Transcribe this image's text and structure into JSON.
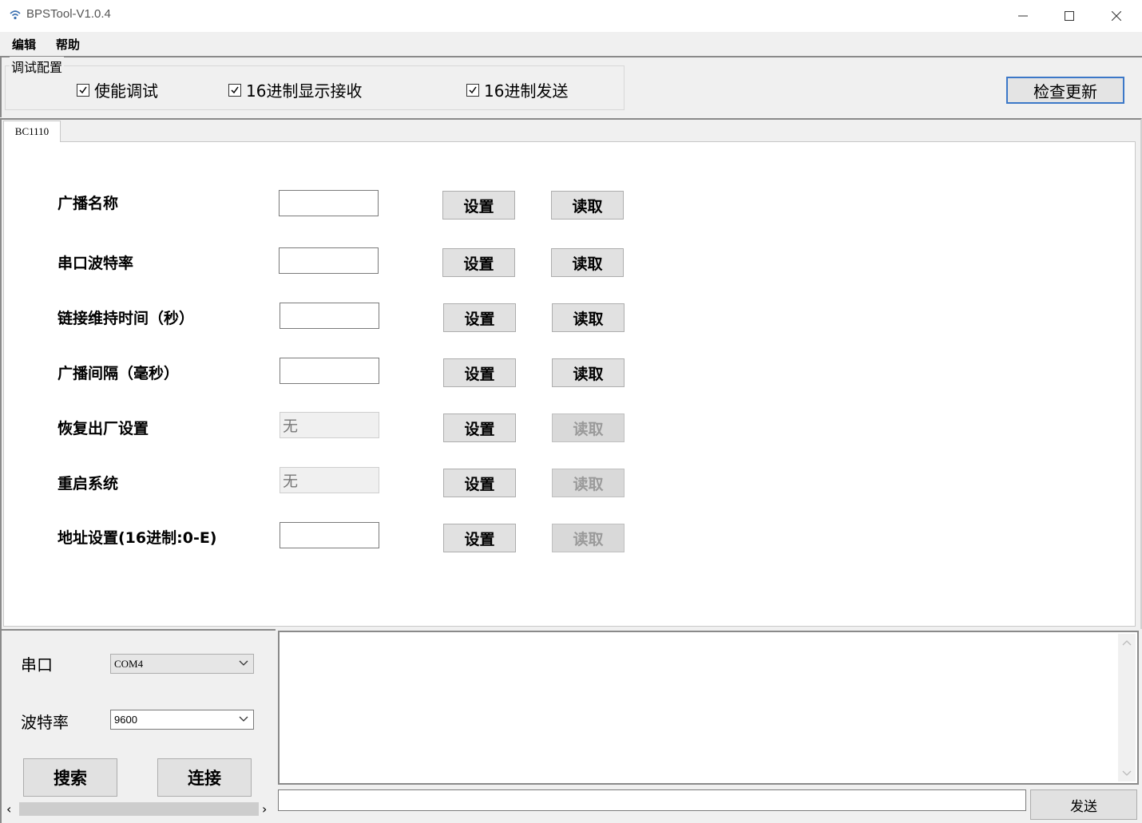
{
  "window": {
    "title": "BPSTool-V1.0.4",
    "minimize": "–",
    "maximize": "□",
    "close": "✕"
  },
  "menu": {
    "edit": "编辑",
    "help": "帮助"
  },
  "config": {
    "legend": "调试配置",
    "enable_debug": "使能调试",
    "hex_display": "16进制显示接收",
    "hex_send": "16进制发送",
    "check_update": "检查更新"
  },
  "tabs": [
    {
      "label": "BC1110"
    }
  ],
  "rows": [
    {
      "label": "广播名称",
      "value": "",
      "set": "设置",
      "read": "读取"
    },
    {
      "label": "串口波特率",
      "value": "",
      "set": "设置",
      "read": "读取"
    },
    {
      "label": "链接维持时间（秒）",
      "value": "",
      "set": "设置",
      "read": "读取"
    },
    {
      "label": "广播间隔（毫秒）",
      "value": "",
      "set": "设置",
      "read": "读取"
    },
    {
      "label": "恢复出厂设置",
      "value": "无",
      "set": "设置",
      "read": "读取"
    },
    {
      "label": "重启系统",
      "value": "无",
      "set": "设置",
      "read": "读取"
    },
    {
      "label": "地址设置(16进制:0-E)",
      "value": "",
      "set": "设置",
      "read": "读取"
    }
  ],
  "serial": {
    "port_label": "串口",
    "port_value": "COM4",
    "baud_label": "波特率",
    "baud_value": "9600",
    "search": "搜索",
    "connect": "连接",
    "scroll_left": "‹",
    "scroll_right": "›"
  },
  "send": {
    "button": "发送",
    "input_value": ""
  },
  "icons": {
    "app": "wifi-icon",
    "check": "✓",
    "dropdown": "chevron-down-icon"
  }
}
